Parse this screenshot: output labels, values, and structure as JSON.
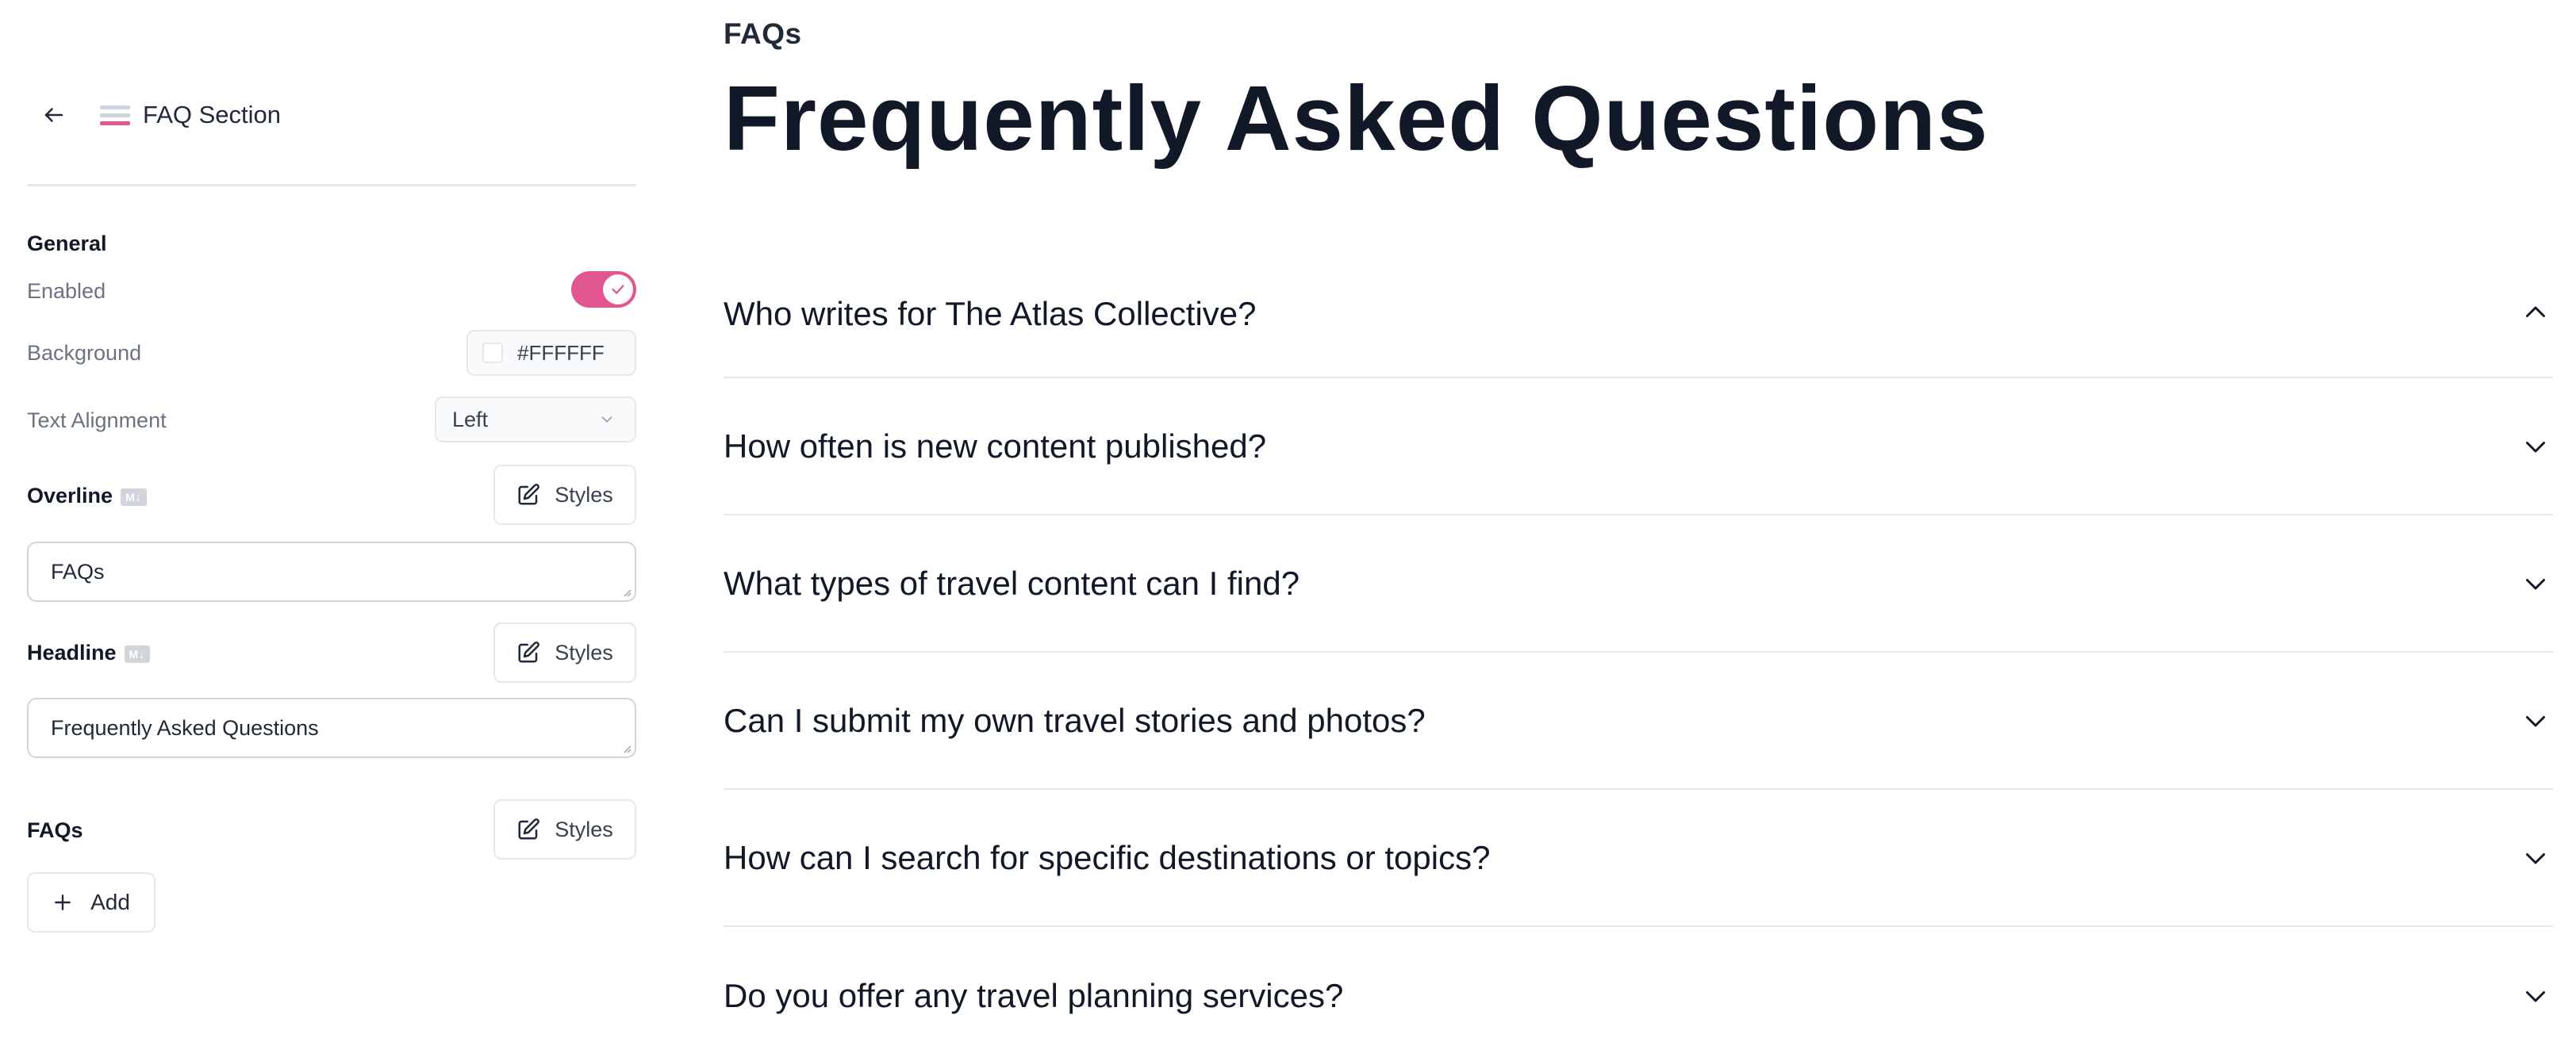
{
  "colors": {
    "accent": "#E25690",
    "section_icon_stripes": [
      "#9ca3af",
      "#9ca3af",
      "#e25690"
    ]
  },
  "sidebar": {
    "title": "FAQ Section",
    "back_icon": "arrow-left-icon",
    "section_icon": "section-layout-icon",
    "general": {
      "label": "General",
      "enabled": {
        "label": "Enabled",
        "value": true
      },
      "background": {
        "label": "Background",
        "value": "#FFFFFF"
      },
      "text_alignment": {
        "label": "Text Alignment",
        "value": "Left"
      }
    },
    "overline": {
      "label": "Overline",
      "badge": "M↓",
      "styles_label": "Styles",
      "value": "FAQs"
    },
    "headline": {
      "label": "Headline",
      "badge": "M↓",
      "styles_label": "Styles",
      "value": "Frequently Asked Questions"
    },
    "faqs": {
      "label": "FAQs",
      "styles_label": "Styles",
      "add_label": "Add"
    }
  },
  "preview": {
    "overline": "FAQs",
    "headline": "Frequently Asked Questions",
    "faqs": [
      {
        "question": "Who writes for The Atlas Collective?",
        "expanded": true
      },
      {
        "question": "How often is new content published?",
        "expanded": false
      },
      {
        "question": "What types of travel content can I find?",
        "expanded": false
      },
      {
        "question": "Can I submit my own travel stories and photos?",
        "expanded": false
      },
      {
        "question": "How can I search for specific destinations or topics?",
        "expanded": false
      },
      {
        "question": "Do you offer any travel planning services?",
        "expanded": false
      }
    ]
  }
}
